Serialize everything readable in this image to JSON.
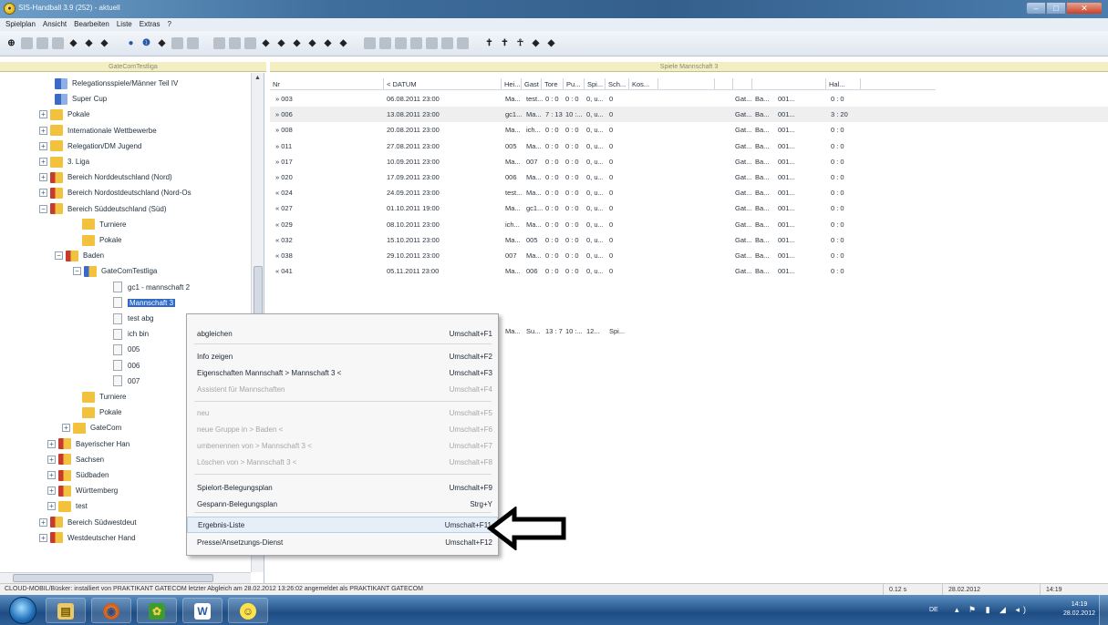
{
  "window": {
    "title": "SIS-Handball 3.9 (252) - aktuell"
  },
  "menu": [
    "Spielplan",
    "Ansicht",
    "Bearbeiten",
    "Liste",
    "Extras",
    "?"
  ],
  "left_pane_title": "GateComTestliga",
  "right_pane_title": "Spiele Mannschaft 3",
  "tree": [
    {
      "label": "Relegationsspiele/Männer Teil IV",
      "indent": 60,
      "folder": "bluesolid",
      "exp": ""
    },
    {
      "label": "Super Cup",
      "indent": 60,
      "folder": "bluesolid",
      "exp": ""
    },
    {
      "label": "Pokale",
      "indent": 55,
      "folder": "yellow",
      "exp": "+"
    },
    {
      "label": "Internationale Wettbewerbe",
      "indent": 55,
      "folder": "yellow",
      "exp": "+"
    },
    {
      "label": "Relegation/DM Jugend",
      "indent": 55,
      "folder": "yellow",
      "exp": "+"
    },
    {
      "label": "3. Liga",
      "indent": 55,
      "folder": "yellow",
      "exp": "+"
    },
    {
      "label": "Bereich Norddeutschland (Nord)",
      "indent": 55,
      "folder": "red",
      "exp": "+"
    },
    {
      "label": "Bereich Nordostdeutschland (Nord-Os",
      "indent": 55,
      "folder": "red",
      "exp": "+"
    },
    {
      "label": "Bereich Süddeutschland (Süd)",
      "indent": 55,
      "folder": "red",
      "exp": "−"
    },
    {
      "label": "Turniere",
      "indent": 90,
      "folder": "yellow",
      "exp": ""
    },
    {
      "label": "Pokale",
      "indent": 90,
      "folder": "yellow",
      "exp": ""
    },
    {
      "label": "Baden",
      "indent": 72,
      "folder": "red",
      "exp": "−"
    },
    {
      "label": "GateComTestliga",
      "indent": 92,
      "folder": "blue",
      "exp": "−"
    },
    {
      "label": "gc1 - mannschaft 2",
      "indent": 124,
      "doc": true
    },
    {
      "label": "Mannschaft 3",
      "indent": 124,
      "doc": true,
      "selected": true
    },
    {
      "label": "test abg",
      "indent": 124,
      "doc": true
    },
    {
      "label": "ich bin",
      "indent": 124,
      "doc": true
    },
    {
      "label": "005",
      "indent": 124,
      "doc": true
    },
    {
      "label": "006",
      "indent": 124,
      "doc": true
    },
    {
      "label": "007",
      "indent": 124,
      "doc": true
    },
    {
      "label": "Turniere",
      "indent": 90,
      "folder": "yellow",
      "exp": ""
    },
    {
      "label": "Pokale",
      "indent": 90,
      "folder": "yellow",
      "exp": ""
    },
    {
      "label": "GateCom",
      "indent": 80,
      "folder": "yellow",
      "exp": "+"
    },
    {
      "label": "Bayerischer Han",
      "indent": 64,
      "folder": "red",
      "exp": "+"
    },
    {
      "label": "Sachsen",
      "indent": 64,
      "folder": "red",
      "exp": "+"
    },
    {
      "label": "Südbaden",
      "indent": 64,
      "folder": "red",
      "exp": "+"
    },
    {
      "label": "Württemberg",
      "indent": 64,
      "folder": "red",
      "exp": "+"
    },
    {
      "label": "test",
      "indent": 64,
      "folder": "yellow",
      "exp": "+"
    },
    {
      "label": "Bereich Südwestdeut",
      "indent": 55,
      "folder": "red",
      "exp": "+"
    },
    {
      "label": "Westdeutscher Hand",
      "indent": 55,
      "folder": "red",
      "exp": "+"
    }
  ],
  "table": {
    "headers": [
      "Nr",
      "< DATUM",
      "Hei...",
      "Gast",
      "Tore",
      "Pu...",
      "Spi...",
      "Sch...",
      "Kos...",
      "",
      "",
      "",
      "",
      "Hal..."
    ],
    "rows": [
      [
        "» 003",
        "06.08.2011 23:00",
        "Ma...",
        "test...",
        "0 : 0",
        "0 : 0",
        "0, u...",
        "0",
        "",
        "Gat...",
        "Ba...",
        "001...",
        "0 : 0"
      ],
      [
        "» 006",
        "13.08.2011 23:00",
        "gc1...",
        "Ma...",
        "7 : 13",
        "10 :...",
        "0, u...",
        "0",
        "",
        "Gat...",
        "Ba...",
        "001...",
        "3 : 20"
      ],
      [
        "» 008",
        "20.08.2011 23:00",
        "Ma...",
        "ich...",
        "0 : 0",
        "0 : 0",
        "0, u...",
        "0",
        "",
        "Gat...",
        "Ba...",
        "001...",
        "0 : 0"
      ],
      [
        "» 011",
        "27.08.2011 23:00",
        "005",
        "Ma...",
        "0 : 0",
        "0 : 0",
        "0, u...",
        "0",
        "",
        "Gat...",
        "Ba...",
        "001...",
        "0 : 0"
      ],
      [
        "» 017",
        "10.09.2011 23:00",
        "Ma...",
        "007",
        "0 : 0",
        "0 : 0",
        "0, u...",
        "0",
        "",
        "Gat...",
        "Ba...",
        "001...",
        "0 : 0"
      ],
      [
        "» 020",
        "17.09.2011 23:00",
        "006",
        "Ma...",
        "0 : 0",
        "0 : 0",
        "0, u...",
        "0",
        "",
        "Gat...",
        "Ba...",
        "001...",
        "0 : 0"
      ],
      [
        "« 024",
        "24.09.2011 23:00",
        "test...",
        "Ma...",
        "0 : 0",
        "0 : 0",
        "0, u...",
        "0",
        "",
        "Gat...",
        "Ba...",
        "001...",
        "0 : 0"
      ],
      [
        "« 027",
        "01.10.2011 19:00",
        "Ma...",
        "gc1...",
        "0 : 0",
        "0 : 0",
        "0, u...",
        "0",
        "",
        "Gat...",
        "Ba...",
        "001...",
        "0 : 0"
      ],
      [
        "« 029",
        "08.10.2011 23:00",
        "ich...",
        "Ma...",
        "0 : 0",
        "0 : 0",
        "0, u...",
        "0",
        "",
        "Gat...",
        "Ba...",
        "001...",
        "0 : 0"
      ],
      [
        "« 032",
        "15.10.2011 23:00",
        "Ma...",
        "005",
        "0 : 0",
        "0 : 0",
        "0, u...",
        "0",
        "",
        "Gat...",
        "Ba...",
        "001...",
        "0 : 0"
      ],
      [
        "« 038",
        "29.10.2011 23:00",
        "007",
        "Ma...",
        "0 : 0",
        "0 : 0",
        "0, u...",
        "0",
        "",
        "Gat...",
        "Ba...",
        "001...",
        "0 : 0"
      ],
      [
        "« 041",
        "05.11.2011 23:00",
        "Ma...",
        "006",
        "0 : 0",
        "0 : 0",
        "0, u...",
        "0",
        "",
        "Gat...",
        "Ba...",
        "001...",
        "0 : 0"
      ]
    ],
    "summary": [
      "Ma...",
      "Su...",
      "13 : 7",
      "10 :...",
      "12...",
      "Spi..."
    ]
  },
  "context_menu": [
    {
      "label": "abgleichen",
      "key": "Umschalt+F1",
      "disabled": false
    },
    {
      "label": "Info zeigen",
      "key": "Umschalt+F2",
      "disabled": false
    },
    {
      "label": "Eigenschaften Mannschaft  > Mannschaft 3 <",
      "key": "Umschalt+F3",
      "disabled": false
    },
    {
      "label": "Assistent für Mannschaften",
      "key": "Umschalt+F4",
      "disabled": true
    },
    {
      "label": "neu",
      "key": "Umschalt+F5",
      "disabled": true
    },
    {
      "label": "neue Gruppe in  > Baden <",
      "key": "Umschalt+F6",
      "disabled": true
    },
    {
      "label": "umbenennen von  > Mannschaft 3 <",
      "key": "Umschalt+F7",
      "disabled": true
    },
    {
      "label": "Löschen von  > Mannschaft 3 <",
      "key": "Umschalt+F8",
      "disabled": true
    },
    {
      "label": "Spielort-Belegungsplan",
      "key": "Umschalt+F9",
      "disabled": false
    },
    {
      "label": "Gespann-Belegungsplan",
      "key": "Strg+Y",
      "disabled": false
    },
    {
      "label": "Ergebnis-Liste",
      "key": "Umschalt+F11",
      "disabled": false,
      "highlight": true
    },
    {
      "label": "Presse/Ansetzungs-Dienst",
      "key": "Umschalt+F12",
      "disabled": false
    }
  ],
  "status": {
    "message": "CLOUD-MOBIL/Büsker: installiert von PRAKTIKANT GATECOM letzter Abgleich am 28.02.2012 13:26:02 angemeldet als PRAKTIKANT GATECOM",
    "elapsed": "0.12 s",
    "date": "28.02.2012",
    "time": "14:19"
  },
  "taskbar": {
    "lang": "DE",
    "clock_time": "14:19",
    "clock_date": "28.02.2012",
    "apps": [
      "explorer-icon",
      "firefox-icon",
      "app-green-icon",
      "word-icon",
      "smiley-icon"
    ]
  },
  "toolbar_icons": [
    "binoculars",
    "grid",
    "grid",
    "grid",
    "tool-a",
    "tool-b",
    "tool-c",
    "globe",
    "info",
    "tool-d",
    "grid",
    "grid",
    "grid",
    "grid",
    "grid",
    "tool-e",
    "tool-f",
    "tool-g",
    "tool-h",
    "tool-i",
    "tool-j",
    "grid",
    "grid",
    "grid",
    "grid",
    "grid",
    "grid",
    "grid",
    "person",
    "person",
    "people",
    "tool-k",
    "tool-l"
  ]
}
